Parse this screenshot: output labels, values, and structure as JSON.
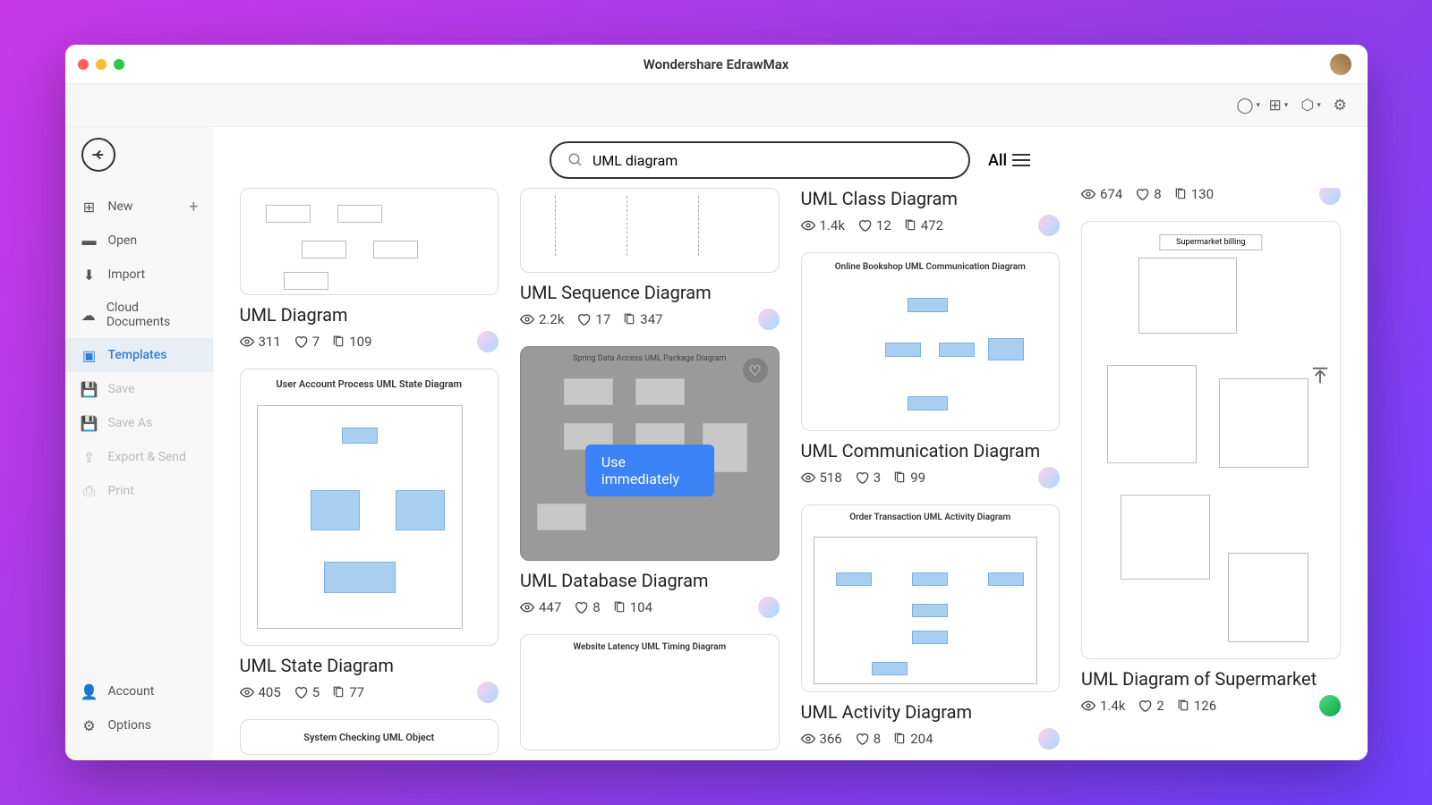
{
  "window": {
    "title": "Wondershare EdrawMax"
  },
  "sidebar": {
    "items": [
      {
        "icon": "plus-box",
        "label": "New",
        "hasPlus": true
      },
      {
        "icon": "folder",
        "label": "Open"
      },
      {
        "icon": "download",
        "label": "Import"
      },
      {
        "icon": "cloud",
        "label": "Cloud Documents"
      },
      {
        "icon": "template",
        "label": "Templates",
        "active": true
      },
      {
        "icon": "save",
        "label": "Save",
        "disabled": true
      },
      {
        "icon": "saveas",
        "label": "Save As",
        "disabled": true
      },
      {
        "icon": "export",
        "label": "Export & Send",
        "disabled": true
      },
      {
        "icon": "print",
        "label": "Print",
        "disabled": true
      }
    ],
    "bottom": [
      {
        "icon": "person",
        "label": "Account"
      },
      {
        "icon": "gear",
        "label": "Options"
      }
    ]
  },
  "search": {
    "value": "UML diagram"
  },
  "filter": {
    "label": "All"
  },
  "hover_button": "Use immediately",
  "templates": {
    "partial_top_right": {
      "views": "674",
      "likes": "8",
      "copies": "130"
    },
    "uml_diagram": {
      "title": "UML Diagram",
      "views": "311",
      "likes": "7",
      "copies": "109"
    },
    "sequence": {
      "title": "UML Sequence Diagram",
      "views": "2.2k",
      "likes": "17",
      "copies": "347"
    },
    "class": {
      "title": "UML Class Diagram",
      "views": "1.4k",
      "likes": "12",
      "copies": "472"
    },
    "communication": {
      "title": "UML Communication Diagram",
      "views": "518",
      "likes": "3",
      "copies": "99"
    },
    "database": {
      "title": "UML Database Diagram",
      "views": "447",
      "likes": "8",
      "copies": "104"
    },
    "state": {
      "title": "UML State Diagram",
      "views": "405",
      "likes": "5",
      "copies": "77"
    },
    "activity": {
      "title": "UML Activity Diagram",
      "views": "366",
      "likes": "8",
      "copies": "204"
    },
    "supermarket": {
      "title": "UML Diagram of Supermarket",
      "views": "1.4k",
      "likes": "2",
      "copies": "126"
    }
  },
  "thumb_labels": {
    "state_title": "User Account Process UML State Diagram",
    "comm_title": "Online Bookshop UML Communication Diagram",
    "activity_title": "Order Transaction UML Activity Diagram",
    "db_title": "Spring Data Access UML Package Diagram",
    "timing_title": "Website Latency UML Timing Diagram",
    "object_title": "System Checking UML Object",
    "super_title": "Supermarket billing"
  }
}
